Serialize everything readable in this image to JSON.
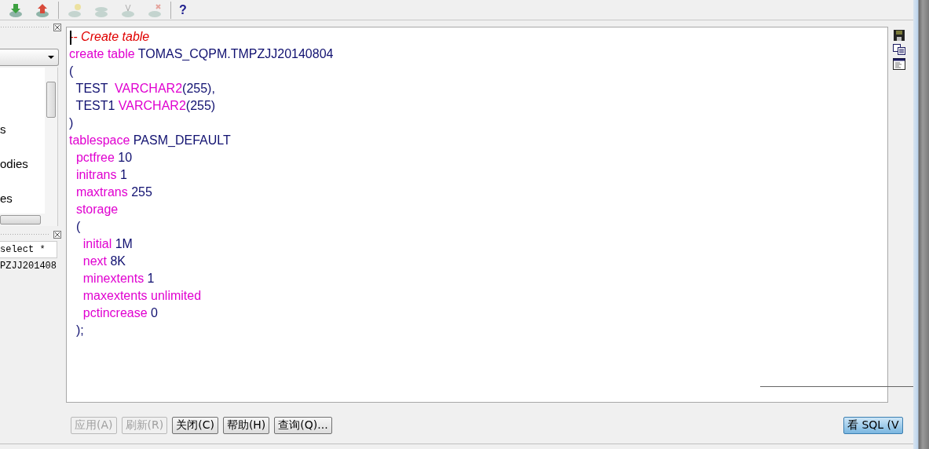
{
  "toolbar": {
    "buttons": [
      {
        "kind": "down",
        "disabled": false
      },
      {
        "kind": "up",
        "disabled": false
      },
      {
        "kind": "sep"
      },
      {
        "kind": "bulb",
        "disabled": true
      },
      {
        "kind": "sql",
        "disabled": true
      },
      {
        "kind": "tool",
        "disabled": true
      },
      {
        "kind": "cross",
        "disabled": true
      },
      {
        "kind": "sep"
      },
      {
        "kind": "help",
        "label": "?"
      }
    ]
  },
  "object_panel": {
    "items": [
      "s",
      "odies",
      "es"
    ]
  },
  "sql_panel": {
    "rows": [
      "select *",
      "PZJJ201408"
    ]
  },
  "editor": {
    "lines": [
      [
        {
          "kind": "comment",
          "text": "-- Create table"
        }
      ],
      [
        {
          "kind": "keyword",
          "text": "create table "
        },
        {
          "kind": "ident",
          "text": "TOMAS_CQPM.TMPZJJ20140804"
        }
      ],
      [
        {
          "kind": "ident",
          "text": "("
        }
      ],
      [
        {
          "kind": "ident",
          "text": "  TEST  "
        },
        {
          "kind": "keyword",
          "text": "VARCHAR2"
        },
        {
          "kind": "ident",
          "text": "(255),"
        }
      ],
      [
        {
          "kind": "ident",
          "text": "  TEST1 "
        },
        {
          "kind": "keyword",
          "text": "VARCHAR2"
        },
        {
          "kind": "ident",
          "text": "(255)"
        }
      ],
      [
        {
          "kind": "ident",
          "text": ")"
        }
      ],
      [
        {
          "kind": "keyword",
          "text": "tablespace "
        },
        {
          "kind": "ident",
          "text": "PASM_DEFAULT"
        }
      ],
      [
        {
          "kind": "keyword",
          "text": "  pctfree "
        },
        {
          "kind": "ident",
          "text": "10"
        }
      ],
      [
        {
          "kind": "keyword",
          "text": "  initrans "
        },
        {
          "kind": "ident",
          "text": "1"
        }
      ],
      [
        {
          "kind": "keyword",
          "text": "  maxtrans "
        },
        {
          "kind": "ident",
          "text": "255"
        }
      ],
      [
        {
          "kind": "keyword",
          "text": "  storage"
        }
      ],
      [
        {
          "kind": "ident",
          "text": "  ("
        }
      ],
      [
        {
          "kind": "keyword",
          "text": "    initial "
        },
        {
          "kind": "ident",
          "text": "1M"
        }
      ],
      [
        {
          "kind": "keyword",
          "text": "    next "
        },
        {
          "kind": "ident",
          "text": "8K"
        }
      ],
      [
        {
          "kind": "keyword",
          "text": "    minextents "
        },
        {
          "kind": "ident",
          "text": "1"
        }
      ],
      [
        {
          "kind": "keyword",
          "text": "    maxextents unlimited"
        }
      ],
      [
        {
          "kind": "keyword",
          "text": "    pctincrease "
        },
        {
          "kind": "ident",
          "text": "0"
        }
      ],
      [
        {
          "kind": "ident",
          "text": "  );"
        }
      ]
    ]
  },
  "side_tools": [
    {
      "kind": "save"
    },
    {
      "kind": "copy"
    },
    {
      "kind": "window"
    }
  ],
  "buttons": [
    {
      "label": "应用(A)",
      "disabled": true,
      "selected": false
    },
    {
      "label": "刷新(R)",
      "disabled": true,
      "selected": false
    },
    {
      "label": "关闭(C)",
      "disabled": false,
      "selected": false
    },
    {
      "label": "帮助(H)",
      "disabled": false,
      "selected": false
    },
    {
      "label": "查询(Q)...",
      "disabled": false,
      "selected": false
    }
  ],
  "view_sql_button": {
    "label": "看 SQL (V",
    "selected": true
  }
}
